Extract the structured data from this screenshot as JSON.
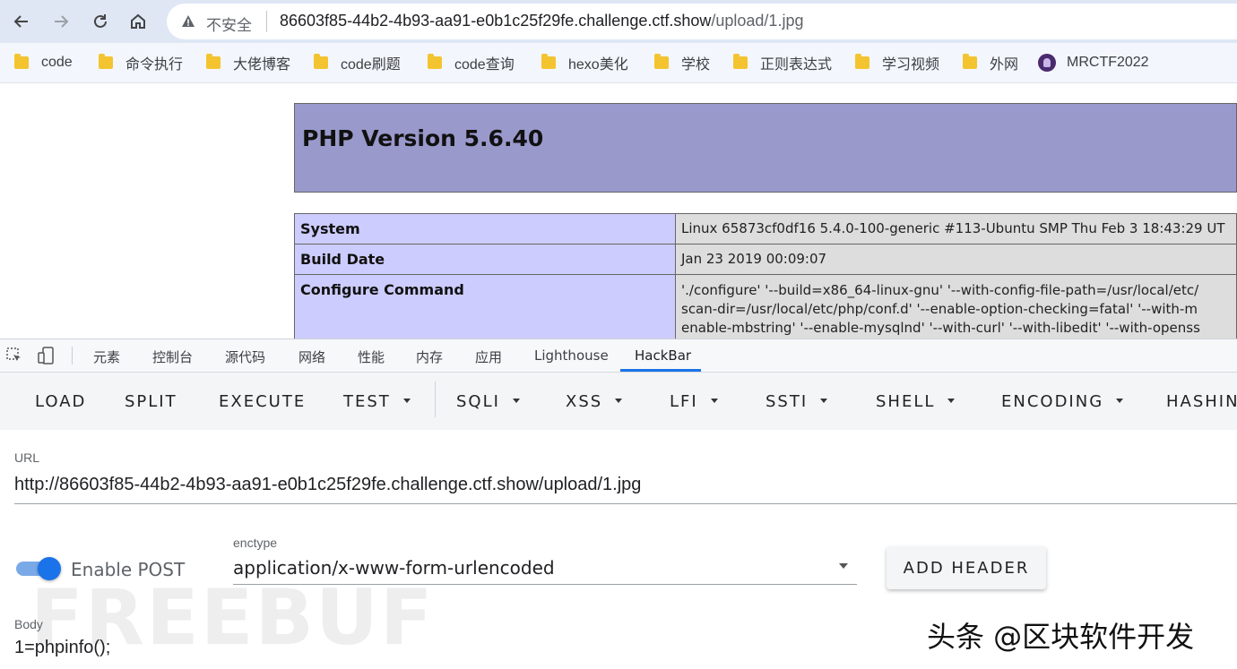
{
  "browser": {
    "security_label": "不安全",
    "url_host": "86603f85-44b2-4b93-aa91-e0b1c25f29fe.challenge.ctf.show",
    "url_path": "/upload/1.jpg",
    "bookmarks": [
      "code",
      "命令执行",
      "大佬博客",
      "code刷题",
      "code查询",
      "hexo美化",
      "学校",
      "正则表达式",
      "学习视频",
      "外网",
      "MRCTF2022"
    ]
  },
  "phpinfo": {
    "title": "PHP Version 5.6.40",
    "rows": [
      {
        "label": "System",
        "value": "Linux 65873cf0df16 5.4.0-100-generic #113-Ubuntu SMP Thu Feb 3 18:43:29 UT"
      },
      {
        "label": "Build Date",
        "value": "Jan 23 2019 00:09:07"
      },
      {
        "label": "Configure Command",
        "lines": [
          "'./configure' '--build=x86_64-linux-gnu' '--with-config-file-path=/usr/local/etc/",
          "scan-dir=/usr/local/etc/php/conf.d' '--enable-option-checking=fatal' '--with-m",
          "enable-mbstring' '--enable-mysqlnd' '--with-curl' '--with-libedit' '--with-openss"
        ]
      }
    ],
    "colors": {
      "header_bg": "#9999cc",
      "label_bg": "#ccccff",
      "value_bg": "#dddddd"
    }
  },
  "devtools": {
    "tabs": [
      "元素",
      "控制台",
      "源代码",
      "网络",
      "性能",
      "内存",
      "应用",
      "Lighthouse",
      "HackBar"
    ],
    "active_tab": "HackBar"
  },
  "hackbar": {
    "toolbar": {
      "load": "LOAD",
      "split": "SPLIT",
      "execute": "EXECUTE",
      "test": "TEST",
      "sqli": "SQLI",
      "xss": "XSS",
      "lfi": "LFI",
      "ssti": "SSTI",
      "shell": "SHELL",
      "encoding": "ENCODING",
      "hashing": "HASHIN"
    },
    "url_label": "URL",
    "url_value": "http://86603f85-44b2-4b93-aa91-e0b1c25f29fe.challenge.ctf.show/upload/1.jpg",
    "enable_post_label": "Enable POST",
    "enable_post_on": true,
    "enctype_label": "enctype",
    "enctype_value": "application/x-www-form-urlencoded",
    "add_header_label": "ADD HEADER",
    "body_label": "Body",
    "body_value": "1=phpinfo();",
    "accent_color": "#1a73e8"
  },
  "watermarks": {
    "logo_text": "FREEBUF",
    "caption": "头条 @区块软件开发"
  }
}
